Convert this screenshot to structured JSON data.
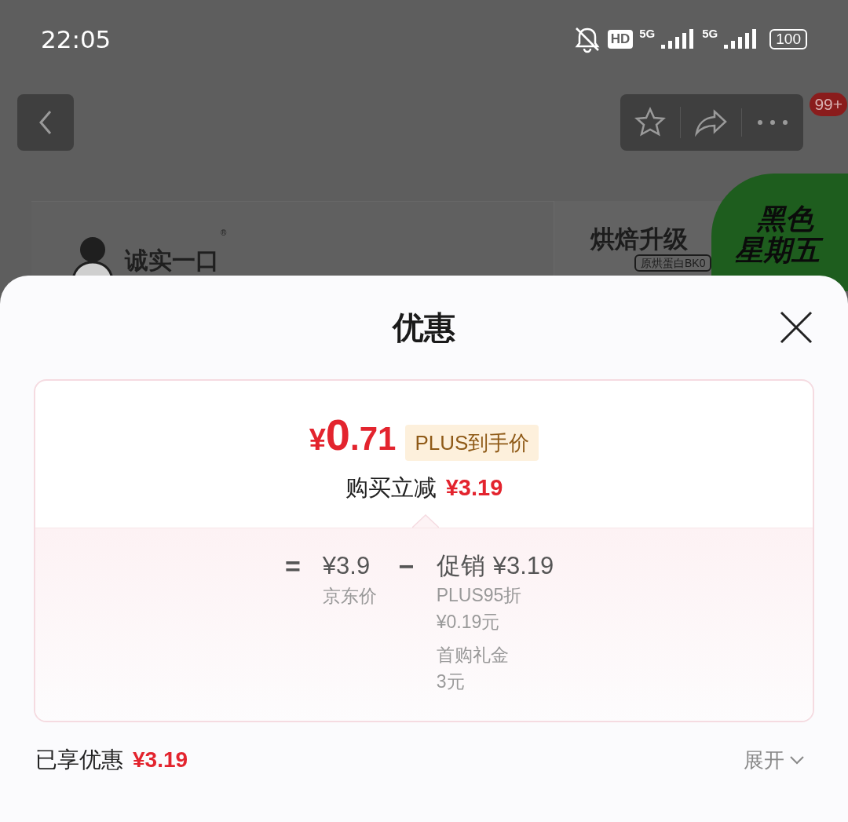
{
  "status_bar": {
    "time": "22:05",
    "hd": "HD",
    "sims": [
      "5G",
      "5G"
    ],
    "battery": "100"
  },
  "background": {
    "badge_count": "99+",
    "brand": "诚实一口",
    "brand_mark": "®",
    "banner_title": "烘焙升级",
    "banner_tag": "原烘蛋白BK0",
    "promo": [
      "黑色",
      "星期五"
    ]
  },
  "sheet": {
    "title": "优惠",
    "summary": {
      "price_symbol": "¥",
      "price_int": "0",
      "price_dec": ".71",
      "price_tag": "PLUS到手价",
      "reduction_label": "购买立减",
      "reduction": "¥3.19"
    },
    "formula": {
      "equals": "=",
      "base_price": "¥3.9",
      "base_label": "京东价",
      "minus": "−",
      "promo_label": "促销",
      "promo_amount": "¥3.19",
      "details": [
        {
          "name": "PLUS95折",
          "amount": "¥0.19元"
        },
        {
          "name": "首购礼金",
          "amount": "3元"
        }
      ]
    },
    "footer": {
      "label": "已享优惠",
      "amount": "¥3.19",
      "toggle": "展开",
      "expanded": false
    }
  }
}
